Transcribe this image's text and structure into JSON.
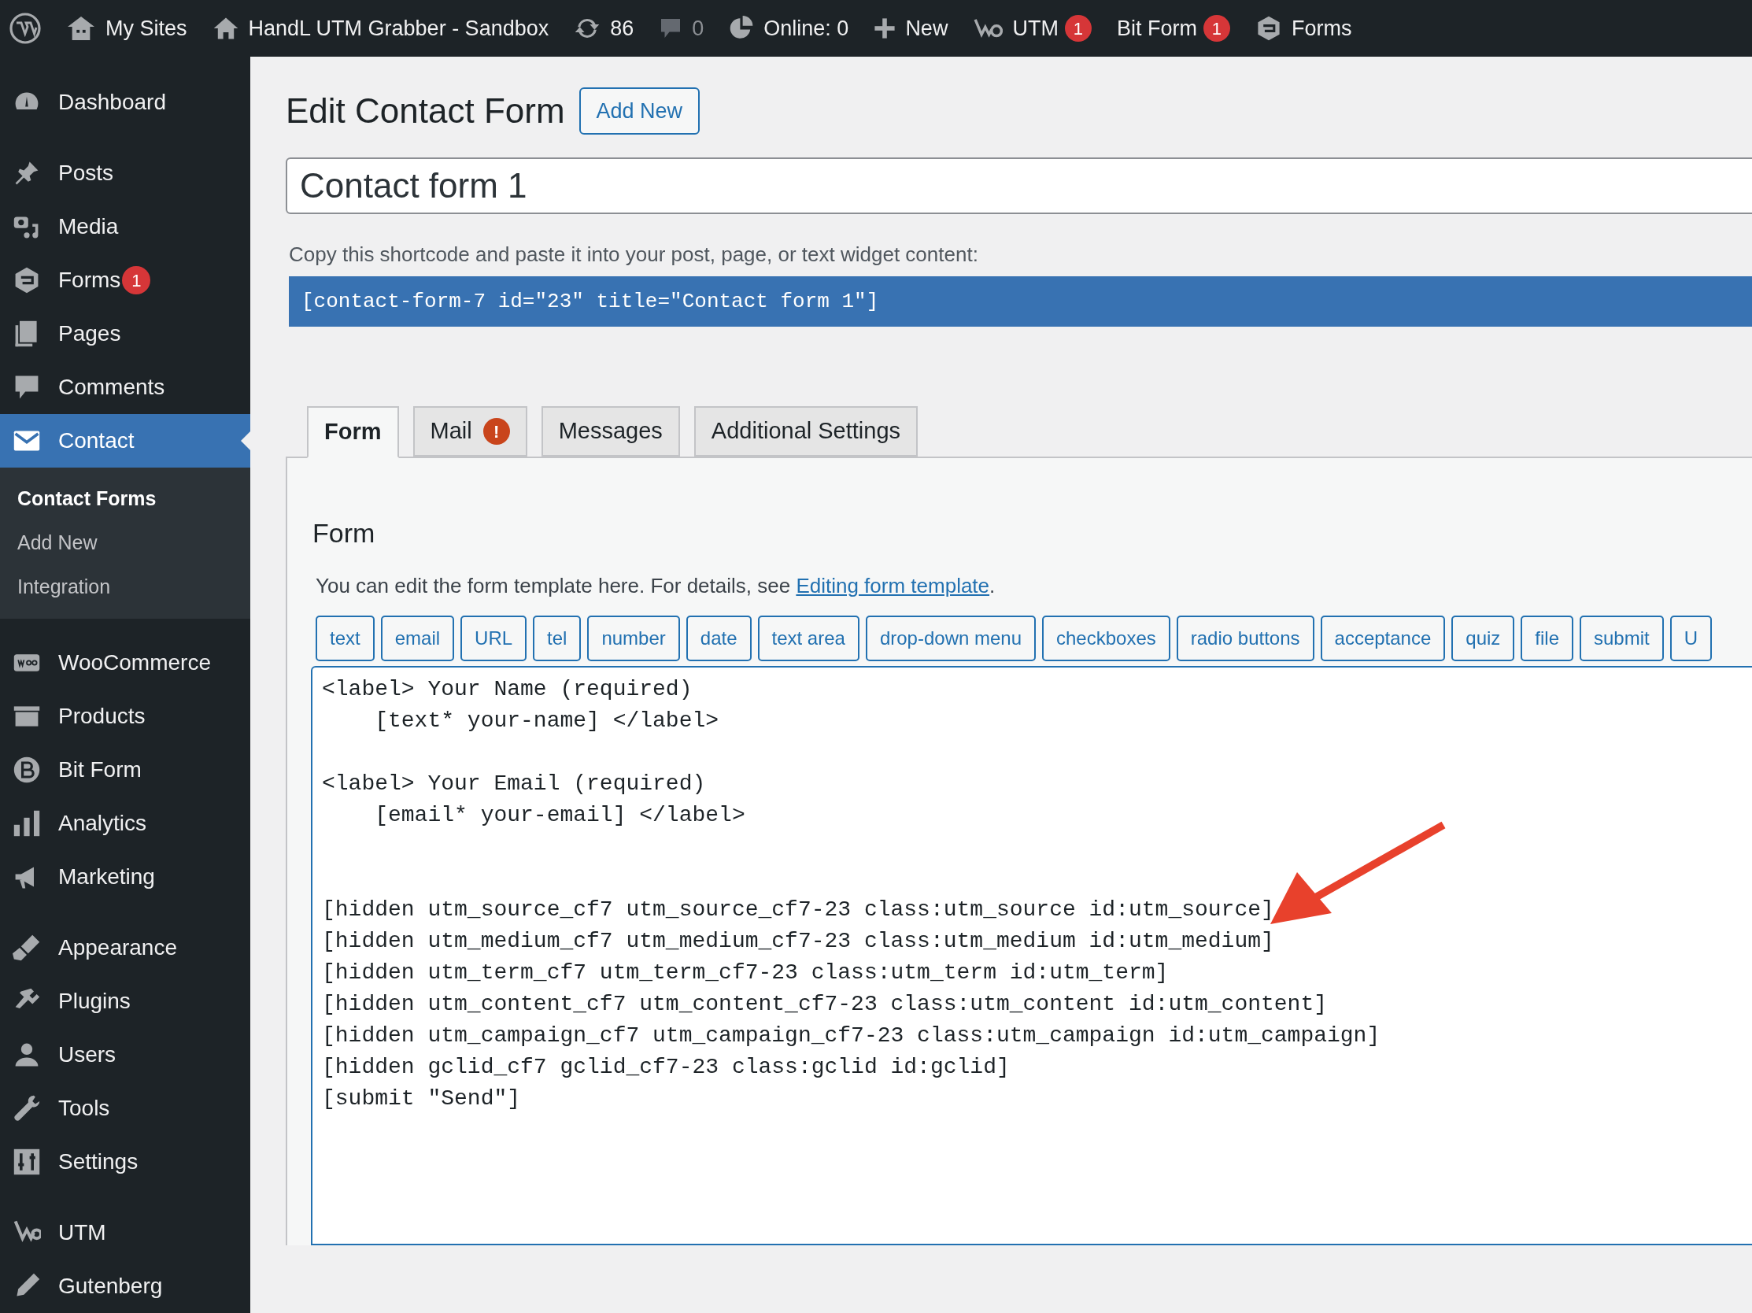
{
  "top_bar": {
    "items": [
      {
        "label": "My Sites",
        "dimmed": false
      },
      {
        "label": "HandL UTM Grabber - Sandbox",
        "dimmed": false
      },
      {
        "label": "86",
        "dimmed": false
      },
      {
        "label": "0",
        "dimmed": true
      },
      {
        "label": "Online: 0",
        "dimmed": false
      },
      {
        "label": "New",
        "dimmed": false
      },
      {
        "label": "UTM",
        "badge": "1",
        "dimmed": false
      },
      {
        "label": "Bit Form",
        "badge": "1",
        "dimmed": false
      },
      {
        "label": "Forms",
        "dimmed": false
      }
    ]
  },
  "sidebar": {
    "groups": [
      {
        "items": [
          {
            "label": "Dashboard",
            "selected": false
          }
        ]
      },
      {
        "items": [
          {
            "label": "Posts",
            "selected": false
          },
          {
            "label": "Media",
            "selected": false
          },
          {
            "label": "Forms",
            "badge": "1",
            "selected": false
          },
          {
            "label": "Pages",
            "selected": false
          },
          {
            "label": "Comments",
            "selected": false
          },
          {
            "label": "Contact",
            "selected": true,
            "submenu": [
              {
                "label": "Contact Forms",
                "selected": true
              },
              {
                "label": "Add New",
                "selected": false
              },
              {
                "label": "Integration",
                "selected": false
              }
            ]
          }
        ]
      },
      {
        "items": [
          {
            "label": "WooCommerce",
            "selected": false
          },
          {
            "label": "Products",
            "selected": false
          },
          {
            "label": "Bit Form",
            "selected": false
          },
          {
            "label": "Analytics",
            "selected": false
          },
          {
            "label": "Marketing",
            "selected": false
          }
        ]
      },
      {
        "items": [
          {
            "label": "Appearance",
            "selected": false
          },
          {
            "label": "Plugins",
            "selected": false
          },
          {
            "label": "Users",
            "selected": false
          },
          {
            "label": "Tools",
            "selected": false
          },
          {
            "label": "Settings",
            "selected": false
          }
        ]
      },
      {
        "items": [
          {
            "label": "UTM",
            "selected": false
          },
          {
            "label": "Gutenberg",
            "selected": false
          }
        ]
      }
    ]
  },
  "page": {
    "title": "Edit Contact Form",
    "add_new_button": "Add New",
    "form_title": {
      "value": "Contact form 1"
    },
    "shortcode_hint": "Copy this shortcode and paste it into your post, page, or text widget content:",
    "shortcode": "[contact-form-7 id=\"23\" title=\"Contact form 1\"]"
  },
  "tabs": [
    {
      "label": "Form",
      "selected": true
    },
    {
      "label": "Mail",
      "alert": "!",
      "selected": false
    },
    {
      "label": "Messages",
      "selected": false
    },
    {
      "label": "Additional Settings",
      "selected": false
    }
  ],
  "form_panel": {
    "heading": "Form",
    "description": "You can edit the form template here. For details, see ",
    "link": "Editing form template",
    "description_end": ".",
    "tag_buttons": [
      "text",
      "email",
      "URL",
      "tel",
      "number",
      "date",
      "text area",
      "drop-down menu",
      "checkboxes",
      "radio buttons",
      "acceptance",
      "quiz",
      "file",
      "submit",
      "U"
    ],
    "template": {
      "value": "<label> Your Name (required)\n    [text* your-name] </label>\n\n<label> Your Email (required)\n    [email* your-email] </label>\n\n\n[hidden utm_source_cf7 utm_source_cf7-23 class:utm_source id:utm_source]\n[hidden utm_medium_cf7 utm_medium_cf7-23 class:utm_medium id:utm_medium]\n[hidden utm_term_cf7 utm_term_cf7-23 class:utm_term id:utm_term]\n[hidden utm_content_cf7 utm_content_cf7-23 class:utm_content id:utm_content]\n[hidden utm_campaign_cf7 utm_campaign_cf7-23 class:utm_campaign id:utm_campaign]\n[hidden gclid_cf7 gclid_cf7-23 class:gclid id:gclid]\n[submit \"Send\"]"
    }
  }
}
